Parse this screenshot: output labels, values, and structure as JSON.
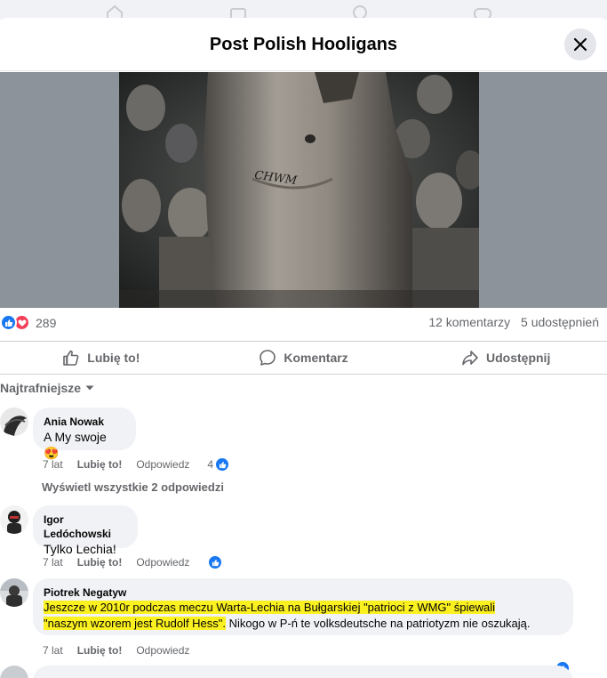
{
  "modal": {
    "title": "Post Polish Hooligans"
  },
  "image": {
    "tattoo_text": "CHWM"
  },
  "stats": {
    "reactions_count": "289",
    "comments": "12 komentarzy",
    "shares": "5 udostępnień"
  },
  "actions": {
    "like": "Lubię to!",
    "comment": "Komentarz",
    "share": "Udostępnij"
  },
  "sort": {
    "label": "Najtrafniejsze"
  },
  "comments": [
    {
      "author": "Ania Nowak",
      "text": "A My swoje",
      "emoji": "😍",
      "age": "7 lat",
      "like": "Lubię to!",
      "reply": "Odpowiedz",
      "likes": "4"
    },
    {
      "author": "Igor Ledóchowski",
      "text": "Tylko Lechia!",
      "age": "7 lat",
      "like": "Lubię to!",
      "reply": "Odpowiedz"
    },
    {
      "author": "Piotrek Negatyw",
      "text_hl1": "Jeszcze w 2010r podczas meczu Warta-Lechia na Bułgarskiej \"patrioci z WMG\" śpiewali",
      "text_hl2": "\"naszym wzorem jest Rudolf Hess\".",
      "text_rest": " Nikogo w P-ń te volksdeutsche na patriotyzm nie oszukają.",
      "age": "7 lat",
      "like": "Lubię to!",
      "reply": "Odpowiedz"
    }
  ],
  "view_replies": "Wyświetl wszystkie 2 odpowiedzi",
  "colors": {
    "brand_blue": "#1877f2",
    "love_red": "#f33e58",
    "highlight": "#fbf020",
    "secondary_text": "#65676b"
  }
}
